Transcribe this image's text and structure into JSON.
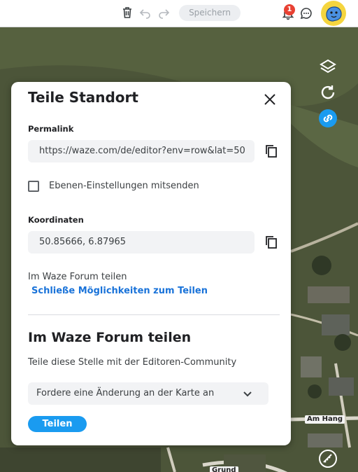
{
  "toolbar": {
    "save_label": "Speichern",
    "notification_count": "1"
  },
  "map": {
    "road_labels": [
      "Am Hang",
      "Grund"
    ]
  },
  "dialog": {
    "title": "Teile Standort",
    "permalink": {
      "label": "Permalink",
      "value": "https://waze.com/de/editor?env=row&lat=50"
    },
    "layers_checkbox": {
      "label": "Ebenen-Einstellungen mitsenden",
      "checked": false
    },
    "coordinates": {
      "label": "Koordinaten",
      "value": "50.85666, 6.87965"
    },
    "forum_small_label": "Im Waze Forum teilen",
    "close_options_link": "Schließe Möglichkeiten zum Teilen",
    "forum_section": {
      "title": "Im Waze Forum teilen",
      "description": "Teile diese Stelle mit der Editoren-Community",
      "select_value": "Fordere eine Änderung an der Karte an",
      "share_button": "Teilen"
    }
  },
  "colors": {
    "accent": "#1a9bf0",
    "link": "#1a73d9",
    "badge": "#e84133",
    "avatar_bg": "#f5d53f"
  },
  "icons": [
    "trash-icon",
    "undo-icon",
    "redo-icon",
    "bell-icon",
    "chat-icon",
    "layers-icon",
    "refresh-icon",
    "link-icon",
    "ruler-icon",
    "close-icon",
    "copy-icon",
    "chevron-down-icon"
  ]
}
